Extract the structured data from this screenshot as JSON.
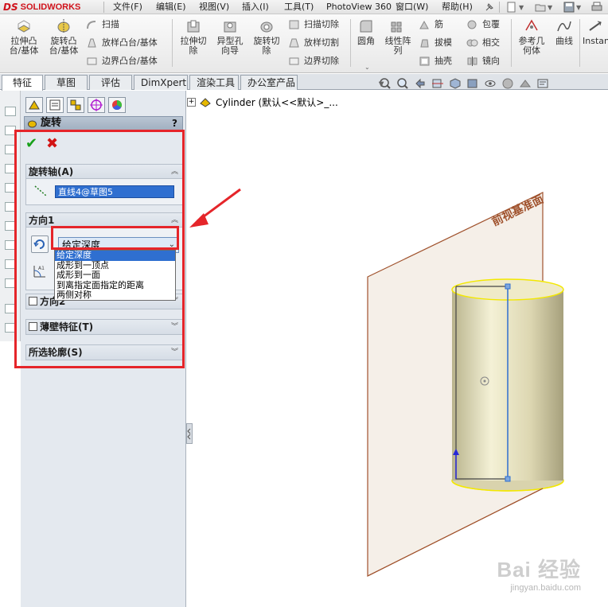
{
  "app": {
    "logo_prefix": "DS",
    "logo_name": "SOLIDWORKS"
  },
  "menu": {
    "items": [
      "文件(F)",
      "编辑(E)",
      "视图(V)",
      "插入(I)",
      "工具(T)",
      "PhotoView 360",
      "窗口(W)",
      "帮助(H)"
    ]
  },
  "commands": {
    "extrude_boss": "拉伸凸\n台/基体",
    "revolve_boss": "旋转凸\n台/基体",
    "sweep": "扫描",
    "loft_boss": "放样凸台/基体",
    "boundary_boss": "边界凸台/基体",
    "extrude_cut": "拉伸切\n除",
    "hole_wizard": "异型孔\n向导",
    "revolve_cut": "旋转切\n除",
    "swept_cut": "扫描切除",
    "lofted_cut": "放样切割",
    "boundary_cut": "边界切除",
    "fillet": "圆角",
    "linear_pattern": "线性阵\n列",
    "rib": "筋",
    "draft": "拔模",
    "shell": "抽壳",
    "wrap": "包覆",
    "intersect": "相交",
    "mirror": "镜向",
    "ref_geometry": "参考几\n何体",
    "curves": "曲线",
    "instant3d": "Instan"
  },
  "tabs": [
    "特征",
    "草图",
    "评估",
    "DimXpert",
    "渲染工具",
    "办公室产品"
  ],
  "active_tab": "特征",
  "panel": {
    "title": "旋转",
    "help": "?",
    "axis_group": {
      "label": "旋转轴(A)",
      "value": "直线4@草图5"
    },
    "dir1_group": {
      "label": "方向1",
      "selected": "给定深度",
      "options": [
        "给定深度",
        "成形到一顶点",
        "成形到一面",
        "到离指定面指定的距离",
        "两侧对称"
      ]
    },
    "dir2_group": {
      "label": "方向2"
    },
    "thin_group": {
      "label": "薄壁特征(T)"
    },
    "contours_group": {
      "label": "所选轮廓(S)"
    }
  },
  "tree": {
    "expander": "+",
    "part_name": "Cylinder  (默认<<默认>_..."
  },
  "viewport": {
    "plane_label": "前视基准面"
  },
  "watermark": {
    "brand": "Bai 经验",
    "url": "jingyan.baidu.com"
  },
  "colors": {
    "accent_red": "#e5252a",
    "selection_blue": "#2f6fd0",
    "plane_brown": "#a0522d",
    "edge_yellow": "#f3e800"
  }
}
